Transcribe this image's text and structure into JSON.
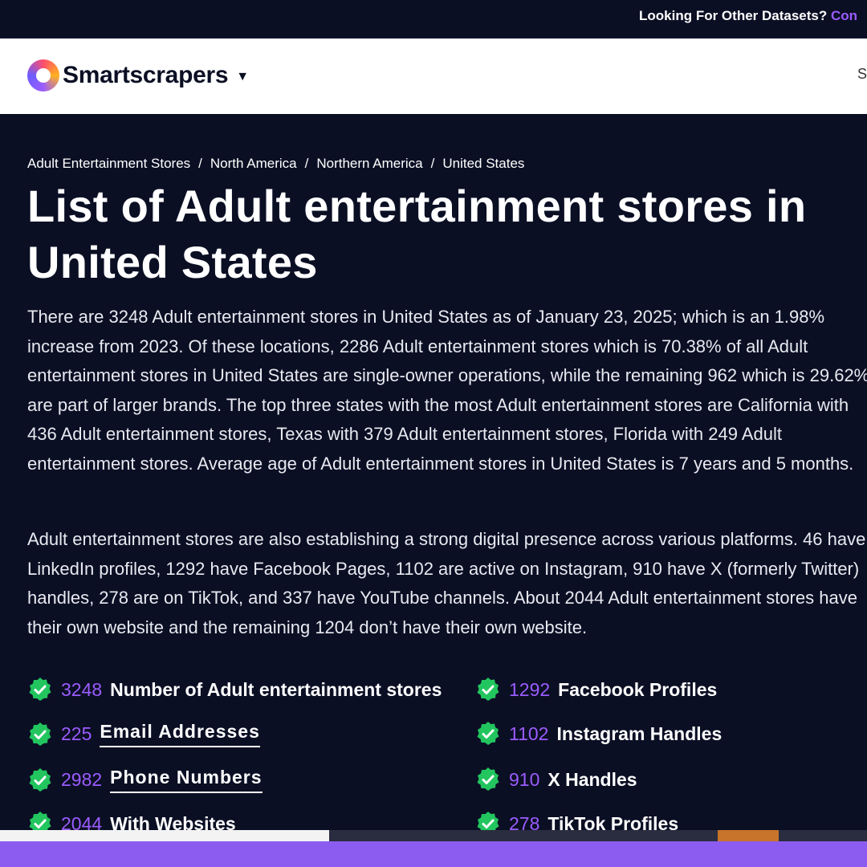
{
  "topbar": {
    "text": "Looking For Other Datasets?",
    "link": "Con"
  },
  "header": {
    "brand": "Smartscrapers",
    "cut_nav": "S"
  },
  "breadcrumb": [
    "Adult Entertainment Stores",
    "North America",
    "Northern America",
    "United States"
  ],
  "page_title": "List of Adult entertainment stores in United States",
  "paragraphs": [
    "There are 3248 Adult entertainment stores in United States as of January 23, 2025; which is an 1.98% increase from 2023. Of these locations, 2286 Adult entertainment stores which is 70.38% of all Adult entertainment stores in United States are single-owner operations, while the remaining 962 which is 29.62% are part of larger brands. The top three states with the most Adult entertainment stores are California with 436 Adult entertainment stores, Texas with 379 Adult entertainment stores, Florida with 249 Adult entertainment stores. Average age of Adult entertainment stores in United States is 7 years and 5 months.",
    "Adult entertainment stores are also establishing a strong digital presence across various platforms. 46 have LinkedIn profiles, 1292 have Facebook Pages, 1102 are active on Instagram, 910 have X (formerly Twitter) handles, 278 are on TikTok, and 337 have YouTube channels. About 2044 Adult entertainment stores have their own website and the remaining 1204 don’t have their own website."
  ],
  "stats": [
    {
      "value": "3248",
      "label": "Number of Adult entertainment stores"
    },
    {
      "value": "225",
      "label": "Email Addresses"
    },
    {
      "value": "2982",
      "label": "Phone Numbers"
    },
    {
      "value": "2044",
      "label": "With Websites"
    },
    {
      "value": "1292",
      "label": "Facebook Profiles"
    },
    {
      "value": "1102",
      "label": "Instagram Handles"
    },
    {
      "value": "910",
      "label": "X Handles"
    },
    {
      "value": "278",
      "label": "TikTok Profiles"
    }
  ],
  "colors": {
    "background": "#0b0f24",
    "accent": "#9b5cff",
    "check": "#22c55e"
  }
}
